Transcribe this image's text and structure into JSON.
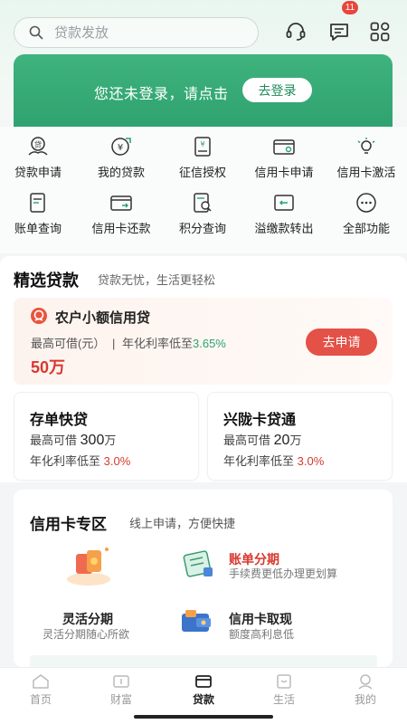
{
  "search": {
    "placeholder": "贷款发放"
  },
  "header": {
    "message_count": "11"
  },
  "banner": {
    "text": "您还未登录，请点击",
    "login_label": "去登录"
  },
  "functions": [
    {
      "label": "贷款申请",
      "icon": "loan-apply-icon"
    },
    {
      "label": "我的贷款",
      "icon": "my-loan-icon"
    },
    {
      "label": "征信授权",
      "icon": "credit-auth-icon"
    },
    {
      "label": "信用卡申请",
      "icon": "card-apply-icon"
    },
    {
      "label": "信用卡激活",
      "icon": "card-activate-icon"
    },
    {
      "label": "账单查询",
      "icon": "bill-query-icon"
    },
    {
      "label": "信用卡还款",
      "icon": "card-repay-icon"
    },
    {
      "label": "积分查询",
      "icon": "points-query-icon"
    },
    {
      "label": "溢缴款转出",
      "icon": "overpay-transfer-icon"
    },
    {
      "label": "全部功能",
      "icon": "all-functions-icon"
    }
  ],
  "loans_section": {
    "title": "精选贷款",
    "subtitle": "贷款无忧，生活更轻松",
    "featured": {
      "name": "农户小额信用贷",
      "desc": "最高可借(元）",
      "sep": "|",
      "rate_label": "年化利率低至",
      "rate_value": "3.65%",
      "amount": "50万",
      "apply_label": "去申请"
    },
    "cards": [
      {
        "title": "存单快贷",
        "max_prefix": "最高可借",
        "max_num": "300",
        "max_unit": "万",
        "rate_prefix": "年化利率低至",
        "rate": "3.0%"
      },
      {
        "title": "兴陇卡贷通",
        "max_prefix": "最高可借",
        "max_num": "20",
        "max_unit": "万",
        "rate_prefix": "年化利率低至",
        "rate": "3.0%"
      }
    ]
  },
  "card_zone": {
    "title": "信用卡专区",
    "subtitle": "线上申请，方便快捷",
    "items": [
      {
        "title": "账单分期",
        "sub": "手续费更低办理更划算"
      },
      {
        "title": "灵活分期",
        "sub": "灵活分期随心所欲"
      },
      {
        "title": "信用卡取现",
        "sub": "额度高利息低"
      }
    ]
  },
  "tabs": [
    {
      "label": "首页"
    },
    {
      "label": "财富"
    },
    {
      "label": "贷款"
    },
    {
      "label": "生活"
    },
    {
      "label": "我的"
    }
  ],
  "colors": {
    "brand_green": "#2fa26f",
    "accent_red": "#e45147"
  }
}
